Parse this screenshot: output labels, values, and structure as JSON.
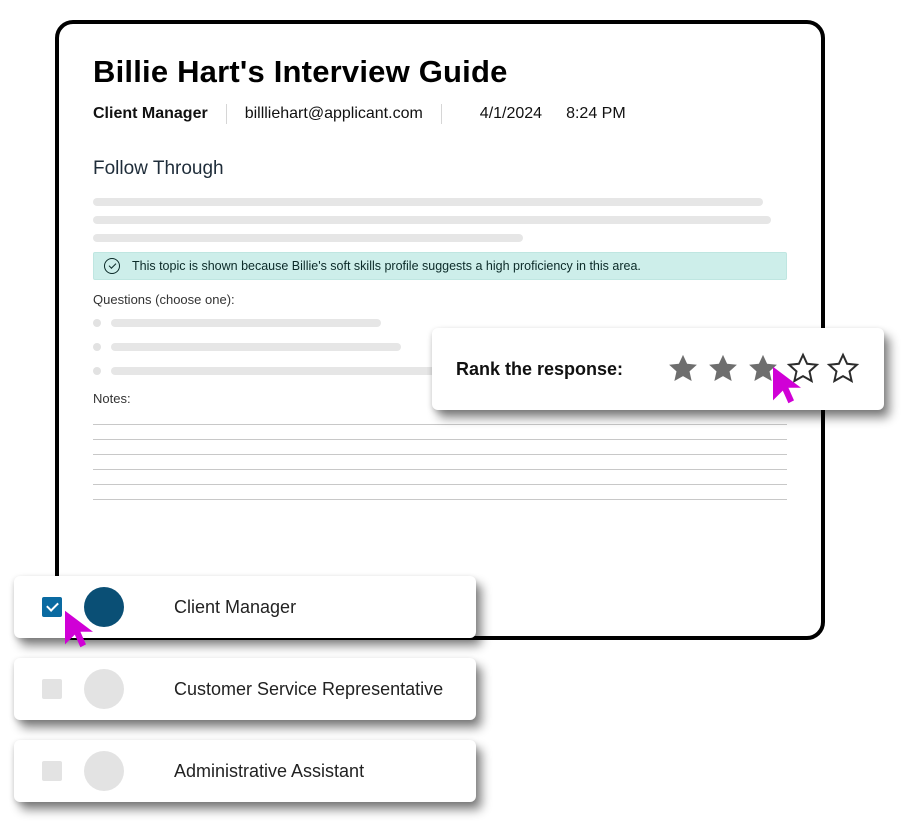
{
  "header": {
    "title": "Billie Hart's Interview Guide",
    "role": "Client Manager",
    "email": "billliehart@applicant.com",
    "date": "4/1/2024",
    "time": "8:24 PM"
  },
  "section": {
    "title": "Follow Through",
    "insight_text": "This topic is shown because Billie's soft skills profile suggests a high proficiency in this area.",
    "questions_label": "Questions (choose one):",
    "notes_label": "Notes:"
  },
  "rank": {
    "label": "Rank the response:",
    "value": 3,
    "max": 5
  },
  "roles": [
    {
      "name": "Client Manager",
      "selected": true
    },
    {
      "name": "Customer Service Representative",
      "selected": false
    },
    {
      "name": "Administrative Assistant",
      "selected": false
    }
  ],
  "colors": {
    "accent_blue": "#0a4f75",
    "check_blue": "#0a6aa1",
    "insight_bg": "#cdeeea",
    "cursor_magenta": "#d000d6",
    "star_filled": "#6e6e6e",
    "star_empty": "#2c2c2c"
  }
}
